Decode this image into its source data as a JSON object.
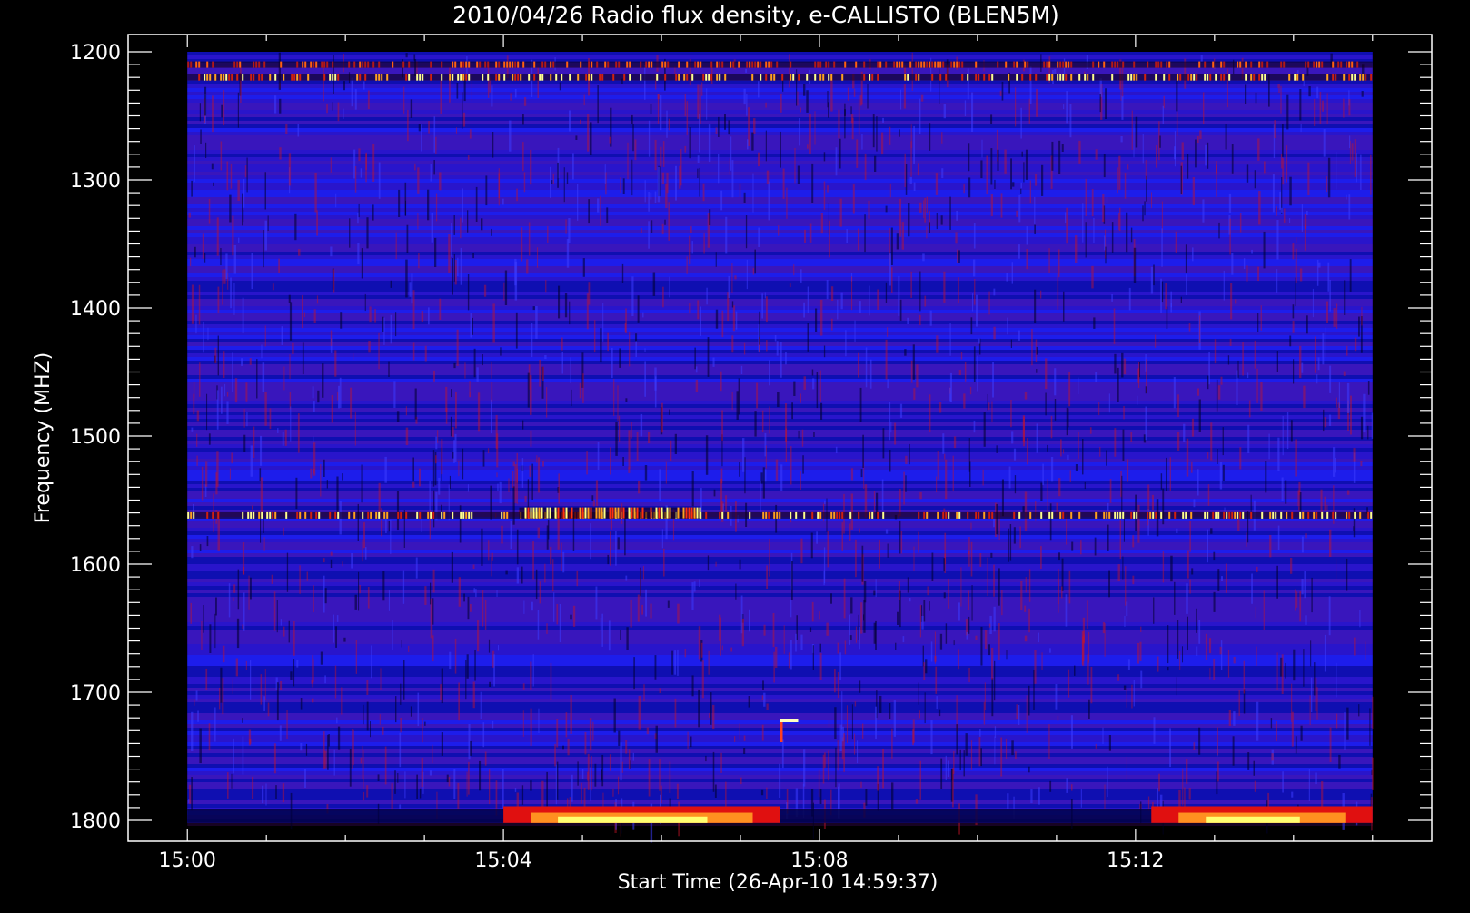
{
  "chart_data": {
    "type": "heatmap",
    "title": "2010/04/26  Radio flux density, e-CALLISTO (BLEN5M)",
    "xlabel": "Start Time (26-Apr-10 14:59:37)",
    "ylabel": "Frequency (MHZ)",
    "x_ticks": [
      {
        "label": "15:00",
        "minutes": 0
      },
      {
        "label": "15:04",
        "minutes": 4
      },
      {
        "label": "15:08",
        "minutes": 8
      },
      {
        "label": "15:12",
        "minutes": 12
      }
    ],
    "y_ticks": [
      {
        "label": "1200",
        "mhz": 1200
      },
      {
        "label": "1300",
        "mhz": 1300
      },
      {
        "label": "1400",
        "mhz": 1400
      },
      {
        "label": "1500",
        "mhz": 1500
      },
      {
        "label": "1600",
        "mhz": 1600
      },
      {
        "label": "1700",
        "mhz": 1700
      },
      {
        "label": "1800",
        "mhz": 1800
      }
    ],
    "xlim_minutes_after_1500": [
      -0.75,
      15.75
    ],
    "data_xlim_minutes_after_1500": [
      0,
      15.0
    ],
    "ylim_mhz": [
      1200,
      1815
    ],
    "data_ylim_mhz": [
      1200,
      1802
    ],
    "y_inverted": true,
    "colormap": [
      "#000000",
      "#1010ff",
      "#d01010",
      "#ff8000",
      "#ffff80"
    ],
    "background_level": "blue with red noise",
    "features": [
      {
        "kind": "persistent emission band",
        "freq_mhz": 1210,
        "t_start": 0,
        "t_end": 15,
        "intensity": "medium"
      },
      {
        "kind": "persistent emission band",
        "freq_mhz": 1220,
        "t_start": 0,
        "t_end": 15,
        "intensity": "high"
      },
      {
        "kind": "persistent emission band",
        "freq_mhz": 1562,
        "t_start": 0,
        "t_end": 15,
        "intensity": "high"
      },
      {
        "kind": "enhanced emission",
        "freq_mhz": 1560,
        "t_start": 4.2,
        "t_end": 6.5,
        "intensity": "very high"
      },
      {
        "kind": "low-frequency edge emission",
        "freq_mhz": 1798,
        "t_start": 4.0,
        "t_end": 7.5,
        "intensity": "very high"
      },
      {
        "kind": "low-frequency edge emission",
        "freq_mhz": 1798,
        "t_start": 12.2,
        "t_end": 15,
        "intensity": "very high"
      },
      {
        "kind": "spike",
        "freq_mhz": 1722,
        "t_start": 7.5,
        "t_end": 7.6,
        "intensity": "very high"
      }
    ]
  }
}
